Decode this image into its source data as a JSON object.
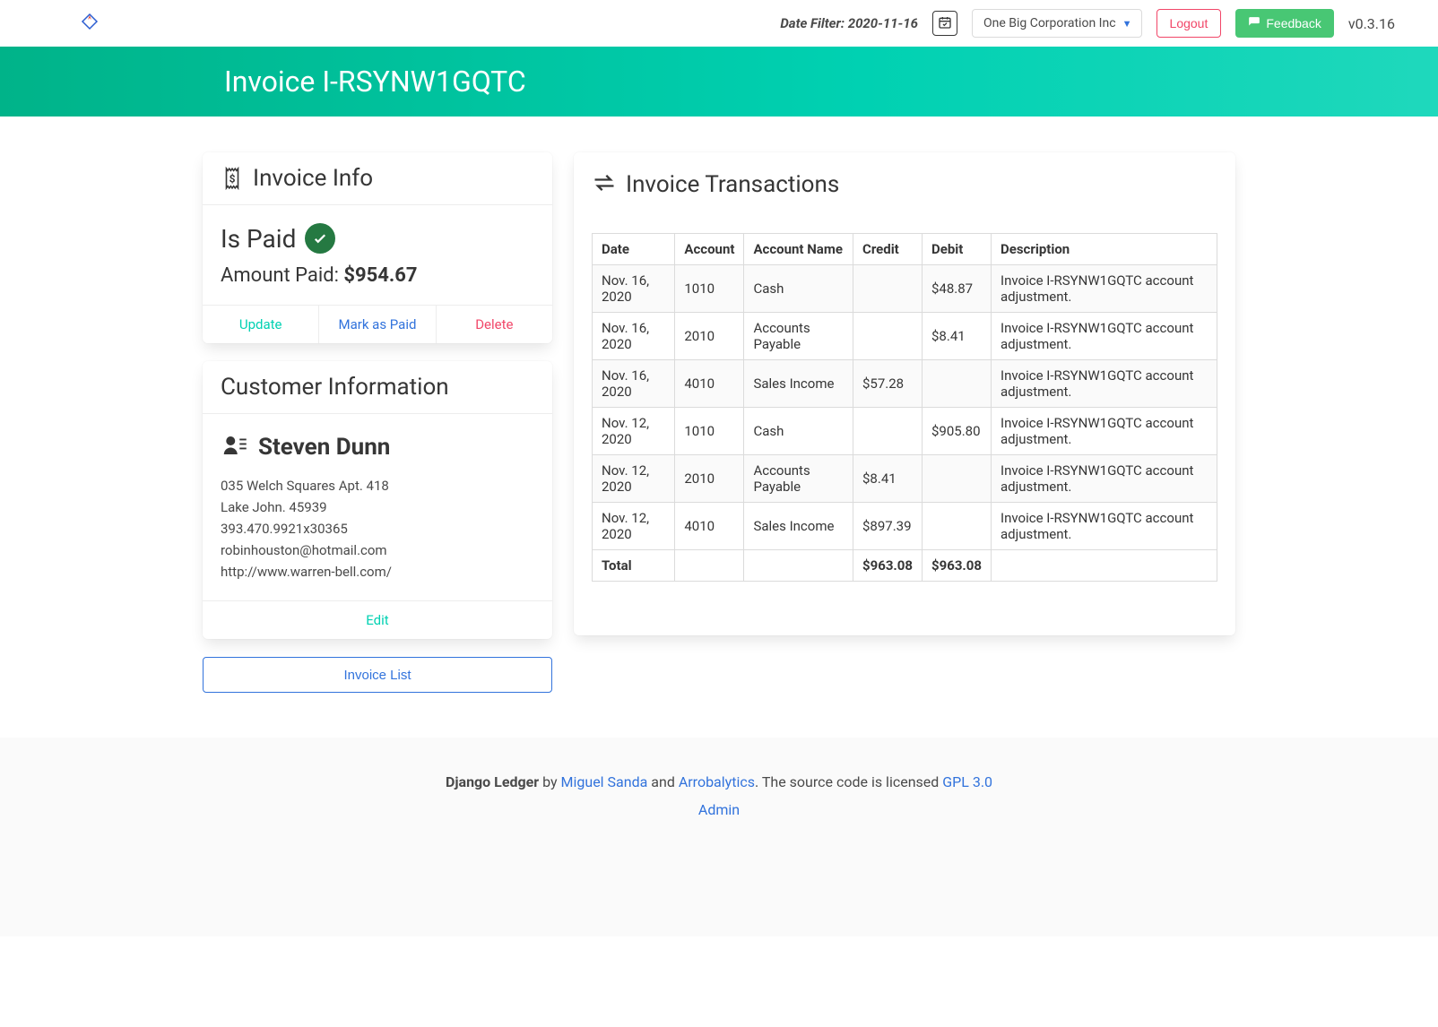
{
  "topbar": {
    "date_filter_label": "Date Filter: 2020-11-16",
    "entity_name": "One Big Corporation Inc",
    "logout_label": "Logout",
    "feedback_label": "Feedback",
    "version": "v0.3.16"
  },
  "hero": {
    "title": "Invoice I-RSYNW1GQTC"
  },
  "invoice_info": {
    "header": "Invoice Info",
    "is_paid_label": "Is Paid",
    "amount_paid_label": "Amount Paid: ",
    "amount_paid_value": "$954.67",
    "actions": {
      "update": "Update",
      "mark_paid": "Mark as Paid",
      "delete": "Delete"
    }
  },
  "customer": {
    "header": "Customer Information",
    "name": "Steven Dunn",
    "address1": "035 Welch Squares Apt. 418",
    "address2": "Lake John. 45939",
    "phone": "393.470.9921x30365",
    "email": "robinhouston@hotmail.com",
    "website": "http://www.warren-bell.com/",
    "edit_label": "Edit"
  },
  "invoice_list_label": "Invoice List",
  "transactions": {
    "header": "Invoice Transactions",
    "columns": {
      "date": "Date",
      "account": "Account",
      "account_name": "Account Name",
      "credit": "Credit",
      "debit": "Debit",
      "description": "Description"
    },
    "rows": [
      {
        "date": "Nov. 16, 2020",
        "account": "1010",
        "account_name": "Cash",
        "credit": "",
        "debit": "$48.87",
        "description": "Invoice I-RSYNW1GQTC account adjustment."
      },
      {
        "date": "Nov. 16, 2020",
        "account": "2010",
        "account_name": "Accounts Payable",
        "credit": "",
        "debit": "$8.41",
        "description": "Invoice I-RSYNW1GQTC account adjustment."
      },
      {
        "date": "Nov. 16, 2020",
        "account": "4010",
        "account_name": "Sales Income",
        "credit": "$57.28",
        "debit": "",
        "description": "Invoice I-RSYNW1GQTC account adjustment."
      },
      {
        "date": "Nov. 12, 2020",
        "account": "1010",
        "account_name": "Cash",
        "credit": "",
        "debit": "$905.80",
        "description": "Invoice I-RSYNW1GQTC account adjustment."
      },
      {
        "date": "Nov. 12, 2020",
        "account": "2010",
        "account_name": "Accounts Payable",
        "credit": "$8.41",
        "debit": "",
        "description": "Invoice I-RSYNW1GQTC account adjustment."
      },
      {
        "date": "Nov. 12, 2020",
        "account": "4010",
        "account_name": "Sales Income",
        "credit": "$897.39",
        "debit": "",
        "description": "Invoice I-RSYNW1GQTC account adjustment."
      }
    ],
    "total_label": "Total",
    "total_credit": "$963.08",
    "total_debit": "$963.08"
  },
  "footer": {
    "project": "Django Ledger",
    "by": " by ",
    "author1": "Miguel Sanda",
    "and": " and ",
    "author2": "Arrobalytics",
    "license_text": ". The source code is licensed ",
    "license": "GPL 3.0",
    "admin": "Admin"
  }
}
